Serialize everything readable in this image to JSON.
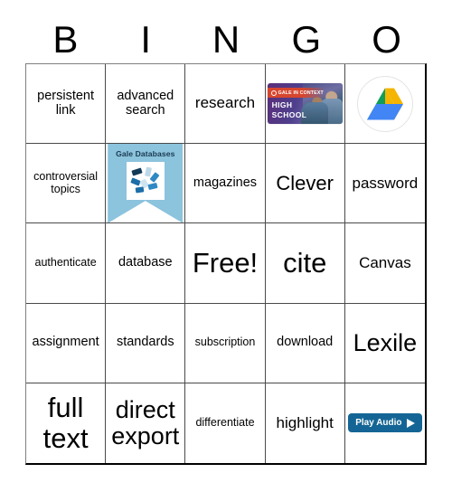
{
  "card": {
    "type": "bingo-card",
    "headers": [
      "B",
      "I",
      "N",
      "G",
      "O"
    ],
    "rows": [
      [
        {
          "kind": "text",
          "text": "persistent link",
          "size": "sm"
        },
        {
          "kind": "text",
          "text": "advanced search",
          "size": "sm"
        },
        {
          "kind": "text",
          "text": "research",
          "size": "md"
        },
        {
          "kind": "image",
          "image": "gale-in-context-high-school-banner"
        },
        {
          "kind": "image",
          "image": "google-drive-icon"
        }
      ],
      [
        {
          "kind": "text",
          "text": "controversial topics",
          "size": "xs"
        },
        {
          "kind": "image",
          "image": "gale-databases-banner"
        },
        {
          "kind": "text",
          "text": "magazines",
          "size": "sm"
        },
        {
          "kind": "text",
          "text": "Clever",
          "size": "lg"
        },
        {
          "kind": "text",
          "text": "password",
          "size": "md"
        }
      ],
      [
        {
          "kind": "text",
          "text": "authenticate",
          "size": "xs"
        },
        {
          "kind": "text",
          "text": "database",
          "size": "sm"
        },
        {
          "kind": "text",
          "text": "Free!",
          "size": "xxl"
        },
        {
          "kind": "text",
          "text": "cite",
          "size": "xxl"
        },
        {
          "kind": "text",
          "text": "Canvas",
          "size": "md"
        }
      ],
      [
        {
          "kind": "text",
          "text": "assignment",
          "size": "sm"
        },
        {
          "kind": "text",
          "text": "standards",
          "size": "sm"
        },
        {
          "kind": "text",
          "text": "subscription",
          "size": "xs"
        },
        {
          "kind": "text",
          "text": "download",
          "size": "sm"
        },
        {
          "kind": "text",
          "text": "Lexile",
          "size": "xl"
        }
      ],
      [
        {
          "kind": "text",
          "text": "full text",
          "size": "xxl"
        },
        {
          "kind": "text",
          "text": "direct export",
          "size": "xl"
        },
        {
          "kind": "text",
          "text": "differentiate",
          "size": "xs"
        },
        {
          "kind": "text",
          "text": "highlight",
          "size": "md"
        },
        {
          "kind": "button",
          "text": "Play Audio",
          "icon": "play-triangle-icon"
        }
      ]
    ]
  },
  "images": {
    "gale_in_context": {
      "eyebrow": "GALE IN CONTEXT",
      "title_line1": "HIGH",
      "title_line2": "SCHOOL",
      "accent_color": "#d6462e",
      "background_color": "#4e3f8c"
    },
    "gale_databases": {
      "title": "Gale Databases",
      "background_color": "#8cc3dd",
      "logo_color": "#1b6ea8"
    },
    "google_drive": {
      "name": "Google Drive",
      "colors": [
        "#0f9d58",
        "#f4b400",
        "#4285f4"
      ]
    }
  },
  "colors": {
    "grid_line": "#4a4a4a",
    "grid_outer": "#000000",
    "text": "#000000",
    "button_blue": "#146595"
  }
}
